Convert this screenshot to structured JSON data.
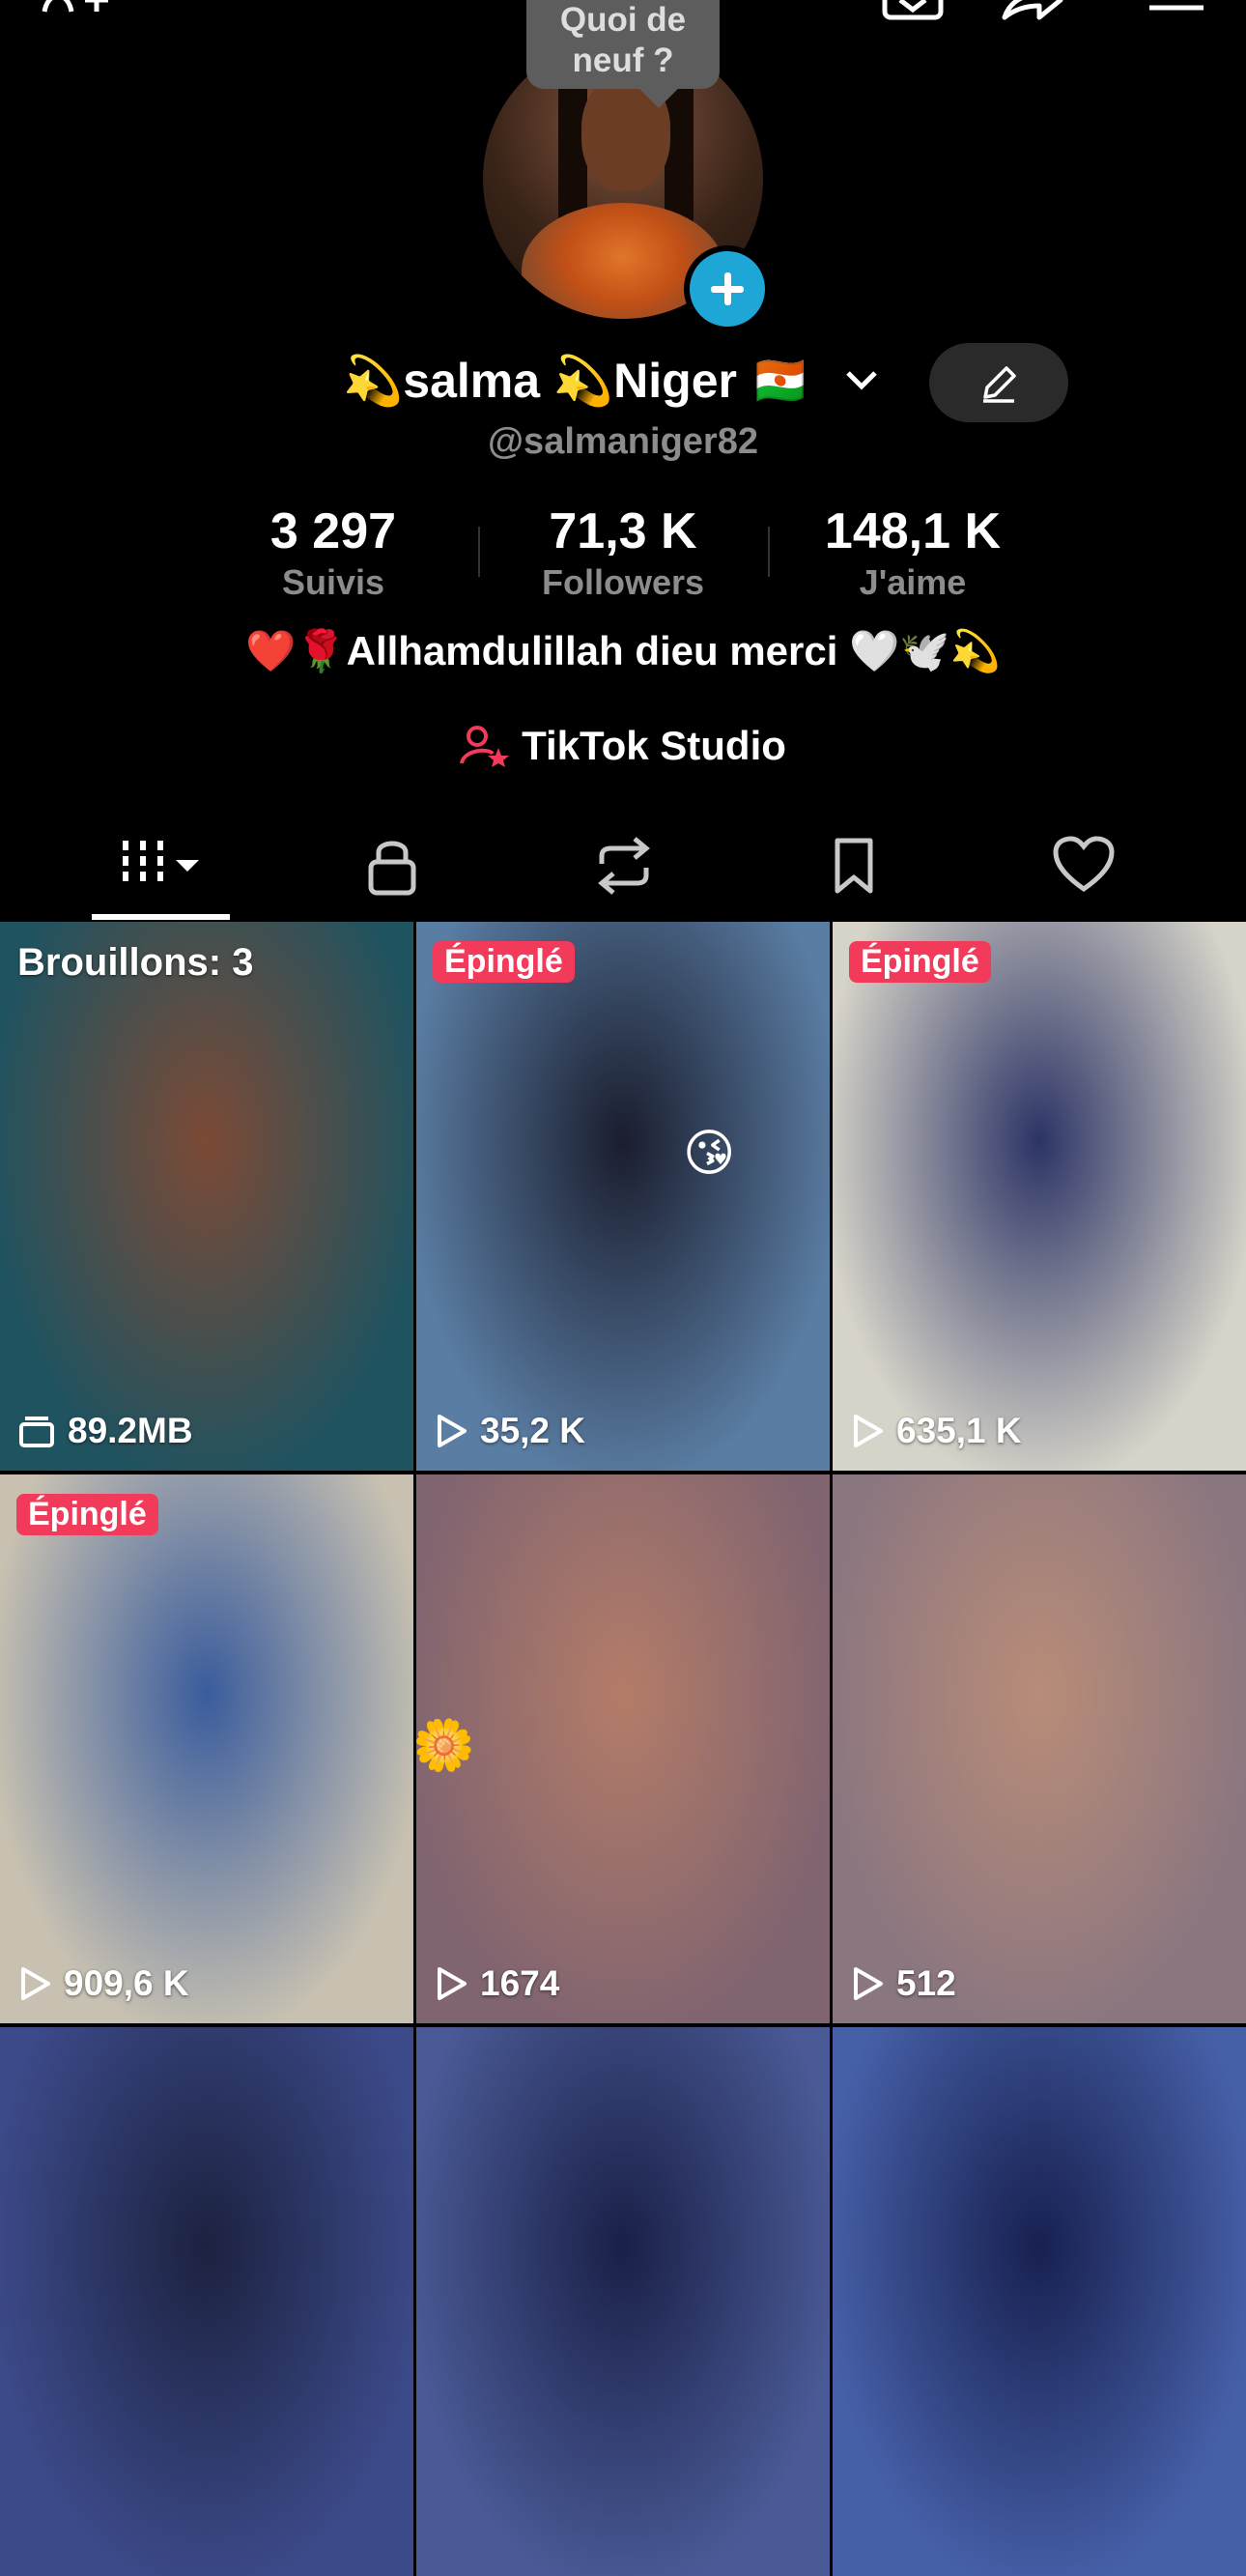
{
  "header": {
    "icons": [
      "add-friend-icon",
      "inbox-icon",
      "share-icon",
      "menu-icon"
    ]
  },
  "avatar": {
    "bubble_text": "Quoi de\nneuf ?"
  },
  "profile": {
    "display_name": "💫salma 💫Niger 🇳🇪",
    "handle": "@salmaniger82",
    "bio": "❤️🌹Allhamdulillah dieu merci 🤍🕊️💫",
    "studio_label": "TikTok Studio"
  },
  "stats": [
    {
      "value": "3 297",
      "label": "Suivis"
    },
    {
      "value": "71,3 K",
      "label": "Followers"
    },
    {
      "value": "148,1 K",
      "label": "J'aime"
    }
  ],
  "tabs": [
    "videos-tab",
    "private-tab",
    "reposts-tab",
    "favorites-tab",
    "liked-tab"
  ],
  "grid": [
    {
      "badge": "",
      "label": "Brouillons: 3",
      "count": "89.2MB",
      "colors": [
        "#1f5360",
        "#7c4a36"
      ]
    },
    {
      "badge": "Épinglé",
      "label": "",
      "count": "35,2 K",
      "colors": [
        "#5a7da3",
        "#1a1d2e"
      ]
    },
    {
      "badge": "Épinglé",
      "label": "",
      "count": "635,1 K",
      "colors": [
        "#d6d3c8",
        "#2c3466"
      ]
    },
    {
      "badge": "Épinglé",
      "label": "",
      "count": "909,6 K",
      "colors": [
        "#c8c1b1",
        "#3a5c9c"
      ]
    },
    {
      "badge": "",
      "label": "",
      "count": "1674",
      "colors": [
        "#806470",
        "#b47c68"
      ]
    },
    {
      "badge": "",
      "label": "",
      "count": "512",
      "colors": [
        "#8a7680",
        "#b98c78"
      ]
    },
    {
      "badge": "",
      "label": "",
      "count": "",
      "colors": [
        "#3c4a8a",
        "#1c2240"
      ]
    },
    {
      "badge": "",
      "label": "",
      "count": "",
      "colors": [
        "#4a5a96",
        "#1a2048"
      ]
    },
    {
      "badge": "",
      "label": "",
      "count": "",
      "colors": [
        "#4660a8",
        "#182050"
      ]
    }
  ],
  "colors": {
    "accent_pin": "#f23a5a",
    "avatar_plus": "#1ea7d6",
    "studio_icon": "#f23a5a"
  }
}
